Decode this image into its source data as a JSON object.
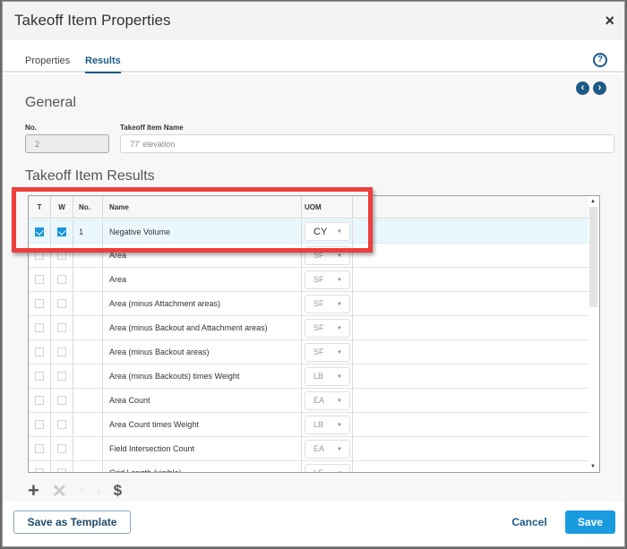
{
  "dialog": {
    "title": "Takeoff Item Properties",
    "close_icon": "×",
    "help_icon": "?"
  },
  "tabs": [
    {
      "label": "Properties",
      "active": false
    },
    {
      "label": "Results",
      "active": true
    }
  ],
  "nav": {
    "prev_icon": "‹",
    "next_icon": "›"
  },
  "general": {
    "title": "General",
    "no_label": "No.",
    "no_value": "2",
    "name_label": "Takeoff Item Name",
    "name_value": "77' elevation"
  },
  "results": {
    "title": "Takeoff Item Results",
    "columns": [
      "T",
      "W",
      "No.",
      "Name",
      "UOM"
    ],
    "rows": [
      {
        "t": true,
        "w": true,
        "no": "1",
        "name": "Negative Volume",
        "uom": "CY",
        "selected": true
      },
      {
        "t": false,
        "w": false,
        "no": "",
        "name": "Area",
        "uom": "SF"
      },
      {
        "t": false,
        "w": false,
        "no": "",
        "name": "Area",
        "uom": "SF"
      },
      {
        "t": false,
        "w": false,
        "no": "",
        "name": "Area (minus Attachment areas)",
        "uom": "SF"
      },
      {
        "t": false,
        "w": false,
        "no": "",
        "name": "Area (minus Backout and Attachment areas)",
        "uom": "SF"
      },
      {
        "t": false,
        "w": false,
        "no": "",
        "name": "Area (minus Backout areas)",
        "uom": "SF"
      },
      {
        "t": false,
        "w": false,
        "no": "",
        "name": "Area (minus Backouts) times Weight",
        "uom": "LB"
      },
      {
        "t": false,
        "w": false,
        "no": "",
        "name": "Area Count",
        "uom": "EA"
      },
      {
        "t": false,
        "w": false,
        "no": "",
        "name": "Area Count times Weight",
        "uom": "LB"
      },
      {
        "t": false,
        "w": false,
        "no": "",
        "name": "Field Intersection Count",
        "uom": "EA"
      },
      {
        "t": false,
        "w": false,
        "no": "",
        "name": "Grid Length (visible)",
        "uom": "LF"
      }
    ]
  },
  "toolbar": {
    "add": "+",
    "remove": "✕",
    "up": "↑",
    "down": "↓",
    "currency": "$"
  },
  "footer": {
    "save_template": "Save as Template",
    "cancel": "Cancel",
    "save": "Save"
  },
  "colors": {
    "accent": "#1a9be0",
    "brand": "#1e5a86",
    "highlight": "#ee3e3e"
  }
}
